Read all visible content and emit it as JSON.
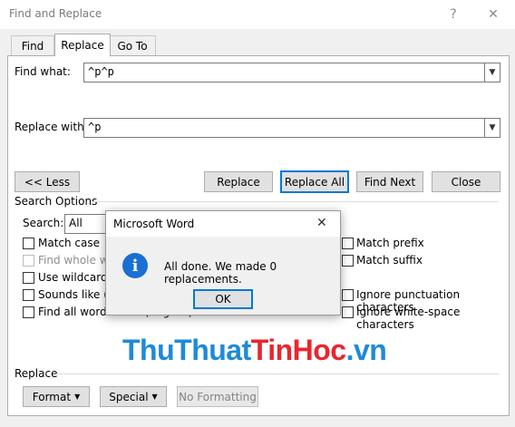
{
  "window": {
    "title": "Find and Replace",
    "help": "?",
    "close": "✕"
  },
  "tabs": [
    {
      "label": "Find"
    },
    {
      "label": "Replace"
    },
    {
      "label": "Go To"
    }
  ],
  "find": {
    "label": "Find what:",
    "value": "^p^p"
  },
  "replace": {
    "label": "Replace with:",
    "value": "^p"
  },
  "buttons": {
    "less": "<< Less",
    "replace": "Replace",
    "replace_all": "Replace All",
    "find_next": "Find Next",
    "close": "Close"
  },
  "search_options": {
    "title": "Search Options",
    "search_label": "Search:",
    "search_value": "All",
    "left": [
      {
        "label": "Match case",
        "enabled": true
      },
      {
        "label": "Find whole wo",
        "enabled": false
      },
      {
        "label": "Use wildcards",
        "enabled": true
      },
      {
        "label": "Sounds like (E",
        "enabled": true
      },
      {
        "label": "Find all word forms (English)",
        "enabled": true
      }
    ],
    "right": [
      {
        "label": "Match prefix"
      },
      {
        "label": "Match suffix"
      },
      {
        "label": "Ignore punctuation characters"
      },
      {
        "label": "Ignore white-space characters"
      }
    ]
  },
  "replace_section": {
    "title": "Replace",
    "format": "Format",
    "special": "Special",
    "no_formatting": "No Formatting"
  },
  "dialog": {
    "title": "Microsoft Word",
    "message": "All done. We made 0 replacements.",
    "ok": "OK",
    "close": "✕",
    "icon": "i"
  },
  "watermark": {
    "part1": "ThuThuat",
    "part2": "TinHoc",
    "part3": ".vn",
    "color1": "#1f8ad6",
    "color2": "#e8262d"
  },
  "colors": {
    "accent": "#0078d7",
    "info": "#1a6fd3"
  }
}
